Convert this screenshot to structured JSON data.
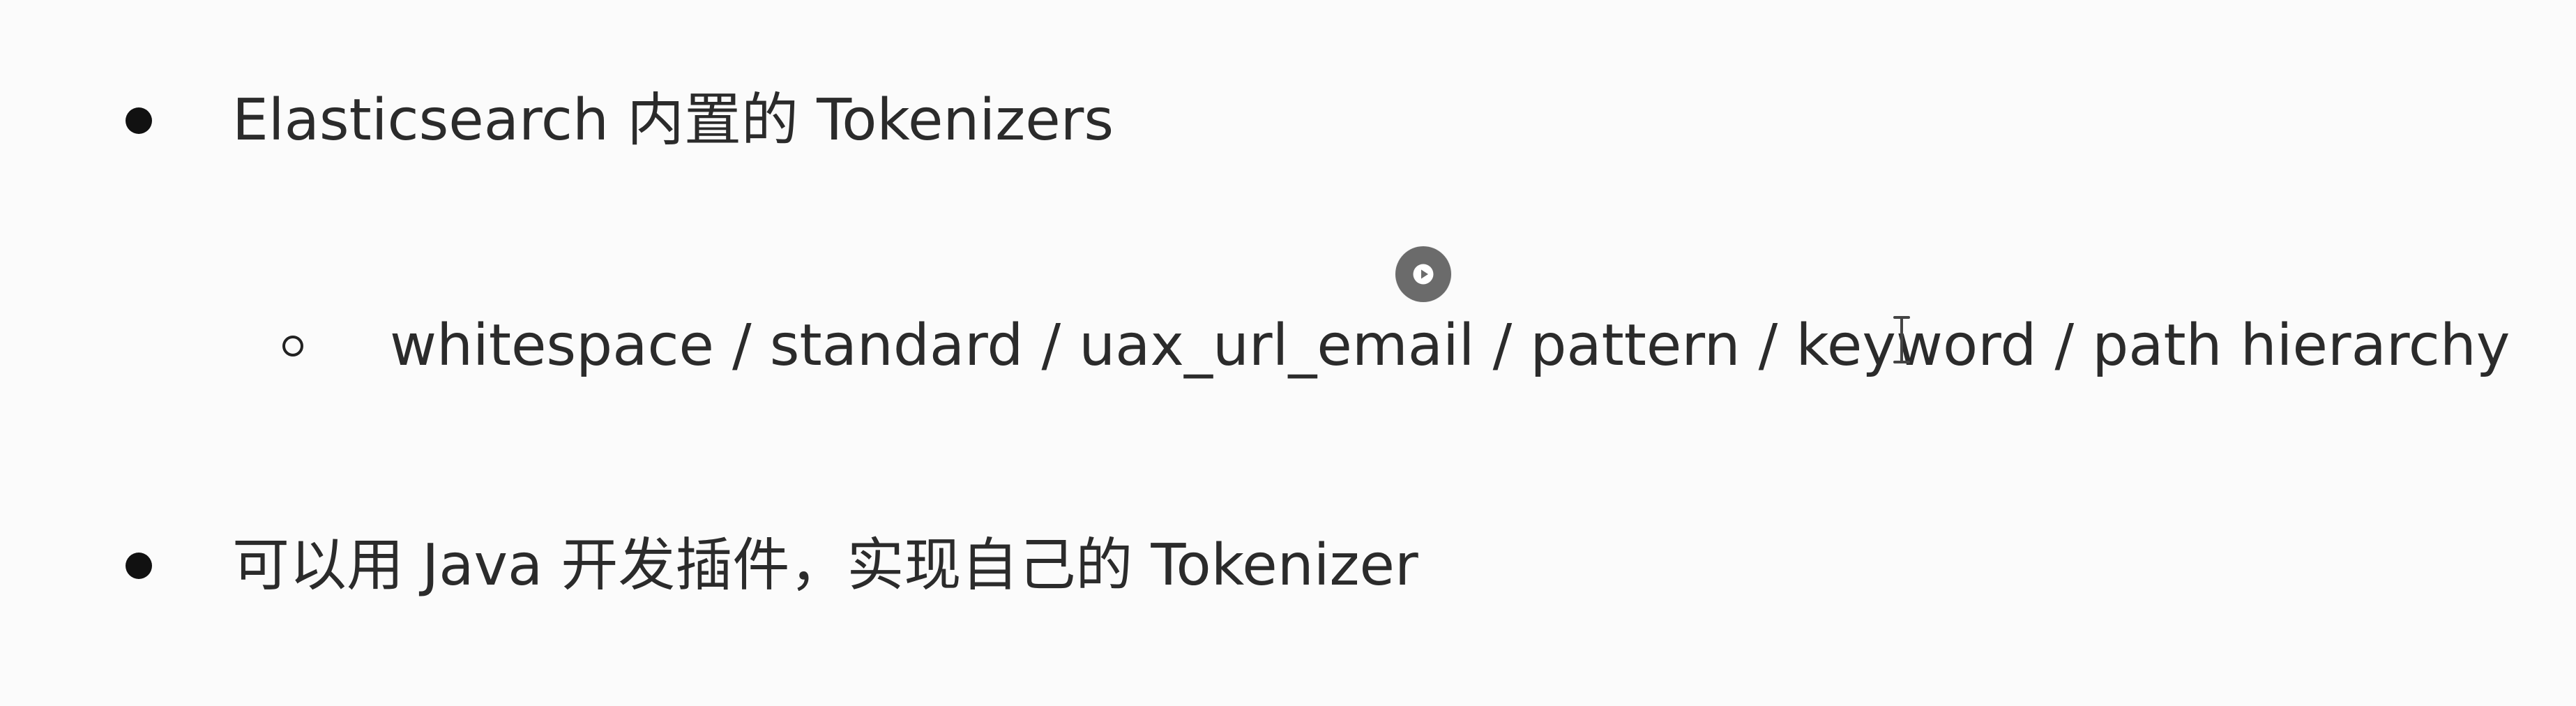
{
  "slide": {
    "bullets": [
      {
        "text": "Elasticsearch 内置的 Tokenizers",
        "level": 1,
        "marker": "disc"
      },
      {
        "text": "whitespace / standard / uax_url_email / pattern / keyword / path hierarchy",
        "level": 2,
        "marker": "circle"
      },
      {
        "text": "可以用 Java 开发插件，实现自己的 Tokenizer",
        "level": 1,
        "marker": "disc"
      }
    ]
  },
  "overlay": {
    "play_icon": "play-icon",
    "cursor_icon": "text-cursor-icon"
  },
  "colors": {
    "background": "#fbfbfb",
    "text": "#2b2b2b",
    "bullet": "#111111",
    "overlay": "#6b6b6b"
  }
}
